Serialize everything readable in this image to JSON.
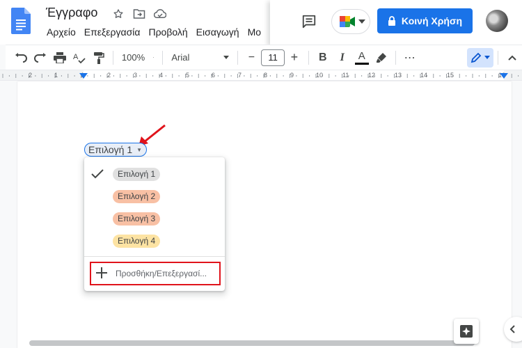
{
  "document": {
    "title": "Έγγραφο"
  },
  "menu": {
    "items": [
      "Αρχείο",
      "Επεξεργασία",
      "Προβολή",
      "Εισαγωγή",
      "Μο"
    ]
  },
  "header_right": {
    "share_label": "Κοινή Χρήση"
  },
  "toolbar": {
    "zoom": "100%",
    "font": "Arial",
    "font_size": "11",
    "minus": "−",
    "plus": "+",
    "bold": "B",
    "italic": "I",
    "text_color": "A",
    "more": "⋯"
  },
  "ruler": {
    "left_number": "2",
    "numbers": [
      "1",
      "1",
      "2",
      "3",
      "4",
      "5",
      "6",
      "7",
      "8",
      "9",
      "10",
      "11",
      "12",
      "13",
      "14",
      "15"
    ],
    "right_number": "16"
  },
  "dropdown_chip": {
    "label": "Επιλογή 1"
  },
  "dropdown": {
    "options": [
      {
        "label": "Επιλογή 1",
        "selected": true,
        "color": "#e0e0e0"
      },
      {
        "label": "Επιλογή 2",
        "selected": false,
        "color": "#f8c0a4"
      },
      {
        "label": "Επιλογή 3",
        "selected": false,
        "color": "#f8c0a4"
      },
      {
        "label": "Επιλογή 4",
        "selected": false,
        "color": "#fde3a3"
      }
    ],
    "add_edit_label": "Προσθήκη/Επεξεργασί..."
  },
  "colors": {
    "accent": "#1a73e8",
    "annotation_red": "#e0131b"
  },
  "icons": {
    "star": "star-icon",
    "move": "move-to-folder-icon",
    "cloud": "cloud-saved-icon",
    "comments": "comments-icon",
    "meet": "google-meet-icon",
    "lock": "lock-icon",
    "explore": "explore-icon"
  }
}
